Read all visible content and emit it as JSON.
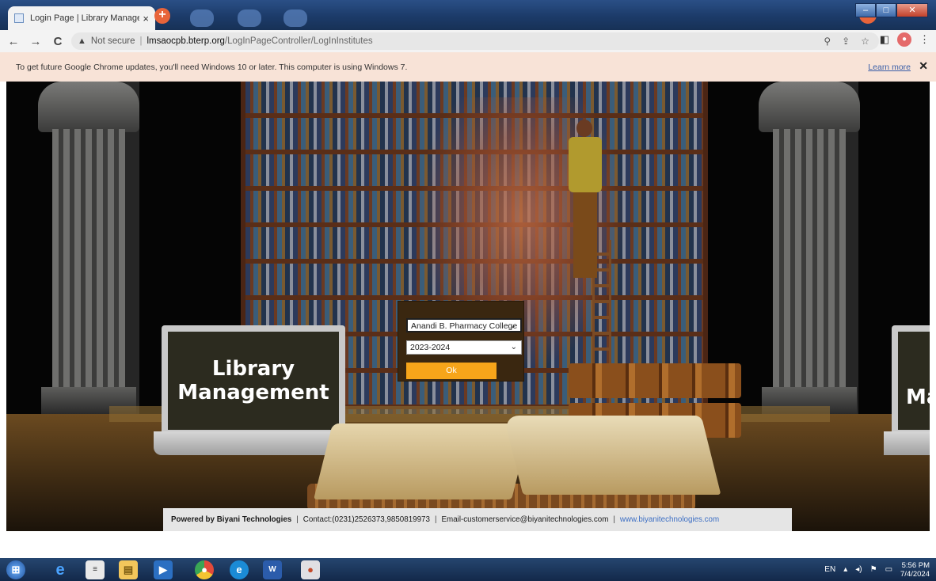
{
  "browser": {
    "tab_title": "Login Page | Library Managemen",
    "tab_close": "×",
    "new_tab": "+",
    "url_warning": "Not secure",
    "url_sep": "|",
    "url_host": "lmsaocpb.bterp.org",
    "url_path": "/LogInPageController/LogInInstitutes"
  },
  "infobar": {
    "message": "To get future Google Chrome updates, you'll need Windows 10 or later. This computer is using Windows 7.",
    "learn_more": "Learn more",
    "close": "✕"
  },
  "hero": {
    "line1": "Library",
    "line2": "Management",
    "right_partial": "Ma"
  },
  "login": {
    "institute": "Anandi B. Pharmacy College",
    "year": "2023-2024",
    "ok_label": "Ok"
  },
  "footer": {
    "powered_by": "Powered by Biyani Technologies",
    "contact": "Contact:(0231)2526373,9850819973",
    "email": "Email-customerservice@biyanitechnologies.com",
    "website": "www.biyanitechnologies.com",
    "separator": "|"
  },
  "taskbar": {
    "lang": "EN",
    "time": "5:56 PM",
    "date": "7/4/2024"
  }
}
